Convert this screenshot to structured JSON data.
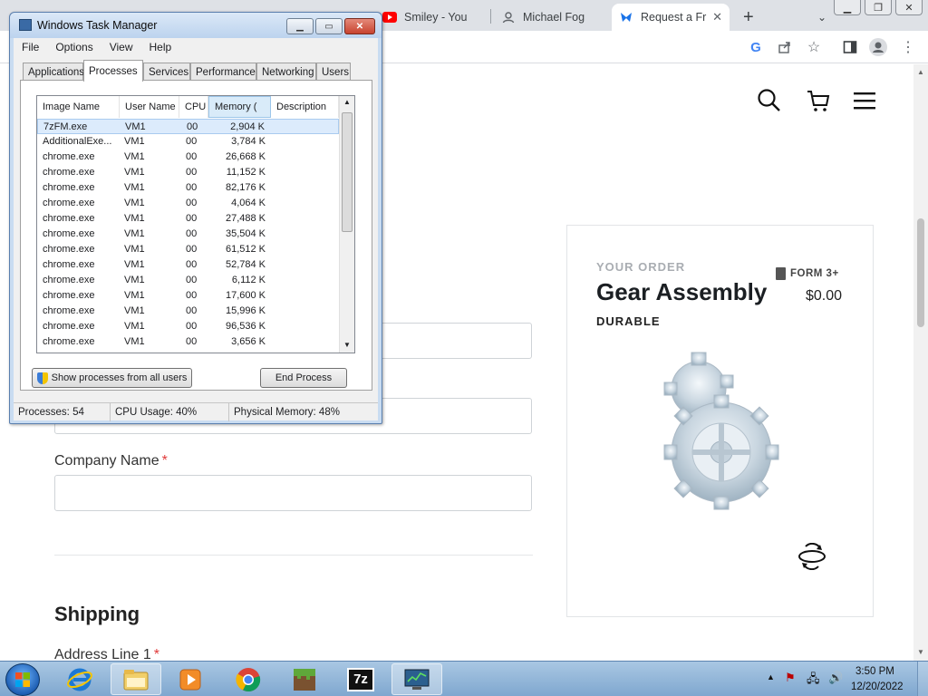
{
  "browser": {
    "tabs": [
      {
        "title": "Smiley - You",
        "icon": "youtube-icon"
      },
      {
        "title": "Michael Fog",
        "icon": "person-icon"
      },
      {
        "title": "Request a Fr",
        "icon": "formlabs-icon",
        "active": true
      }
    ],
    "new_tab": "+"
  },
  "site": {
    "labels": {
      "company_name": "Company Name",
      "required_mark": "*",
      "address_line_1": "Address Line 1"
    },
    "shipping_heading": "Shipping",
    "order": {
      "label": "YOUR ORDER",
      "badge": "FORM 3+",
      "product": "Gear Assembly",
      "price": "$0.00",
      "material": "DURABLE"
    }
  },
  "task_manager": {
    "title": "Windows Task Manager",
    "menu": [
      "File",
      "Options",
      "View",
      "Help"
    ],
    "tabs": [
      "Applications",
      "Processes",
      "Services",
      "Performance",
      "Networking",
      "Users"
    ],
    "columns": [
      "Image Name",
      "User Name",
      "CPU",
      "Memory (",
      "Description"
    ],
    "processes": [
      {
        "name": "7zFM.exe",
        "user": "VM1",
        "cpu": "00",
        "mem": "2,904 K"
      },
      {
        "name": "AdditionalExe...",
        "user": "VM1",
        "cpu": "00",
        "mem": "3,784 K"
      },
      {
        "name": "chrome.exe",
        "user": "VM1",
        "cpu": "00",
        "mem": "26,668 K"
      },
      {
        "name": "chrome.exe",
        "user": "VM1",
        "cpu": "00",
        "mem": "11,152 K"
      },
      {
        "name": "chrome.exe",
        "user": "VM1",
        "cpu": "00",
        "mem": "82,176 K"
      },
      {
        "name": "chrome.exe",
        "user": "VM1",
        "cpu": "00",
        "mem": "4,064 K"
      },
      {
        "name": "chrome.exe",
        "user": "VM1",
        "cpu": "00",
        "mem": "27,488 K"
      },
      {
        "name": "chrome.exe",
        "user": "VM1",
        "cpu": "00",
        "mem": "35,504 K"
      },
      {
        "name": "chrome.exe",
        "user": "VM1",
        "cpu": "00",
        "mem": "61,512 K"
      },
      {
        "name": "chrome.exe",
        "user": "VM1",
        "cpu": "00",
        "mem": "52,784 K"
      },
      {
        "name": "chrome.exe",
        "user": "VM1",
        "cpu": "00",
        "mem": "6,112 K"
      },
      {
        "name": "chrome.exe",
        "user": "VM1",
        "cpu": "00",
        "mem": "17,600 K"
      },
      {
        "name": "chrome.exe",
        "user": "VM1",
        "cpu": "00",
        "mem": "15,996 K"
      },
      {
        "name": "chrome.exe",
        "user": "VM1",
        "cpu": "00",
        "mem": "96,536 K"
      },
      {
        "name": "chrome.exe",
        "user": "VM1",
        "cpu": "00",
        "mem": "3,656 K"
      }
    ],
    "buttons": {
      "show_all": "Show processes from all users",
      "end_process": "End Process"
    },
    "status": {
      "processes": "Processes: 54",
      "cpu": "CPU Usage: 40%",
      "memory": "Physical Memory: 48%"
    }
  },
  "taskbar": {
    "apps": [
      "ie-icon",
      "explorer-icon",
      "media-player-icon",
      "chrome-icon",
      "minecraft-icon",
      "7zip-icon",
      "task-manager-icon"
    ],
    "seven_zip_label": "7z",
    "time": "3:50 PM",
    "date": "12/20/2022"
  }
}
